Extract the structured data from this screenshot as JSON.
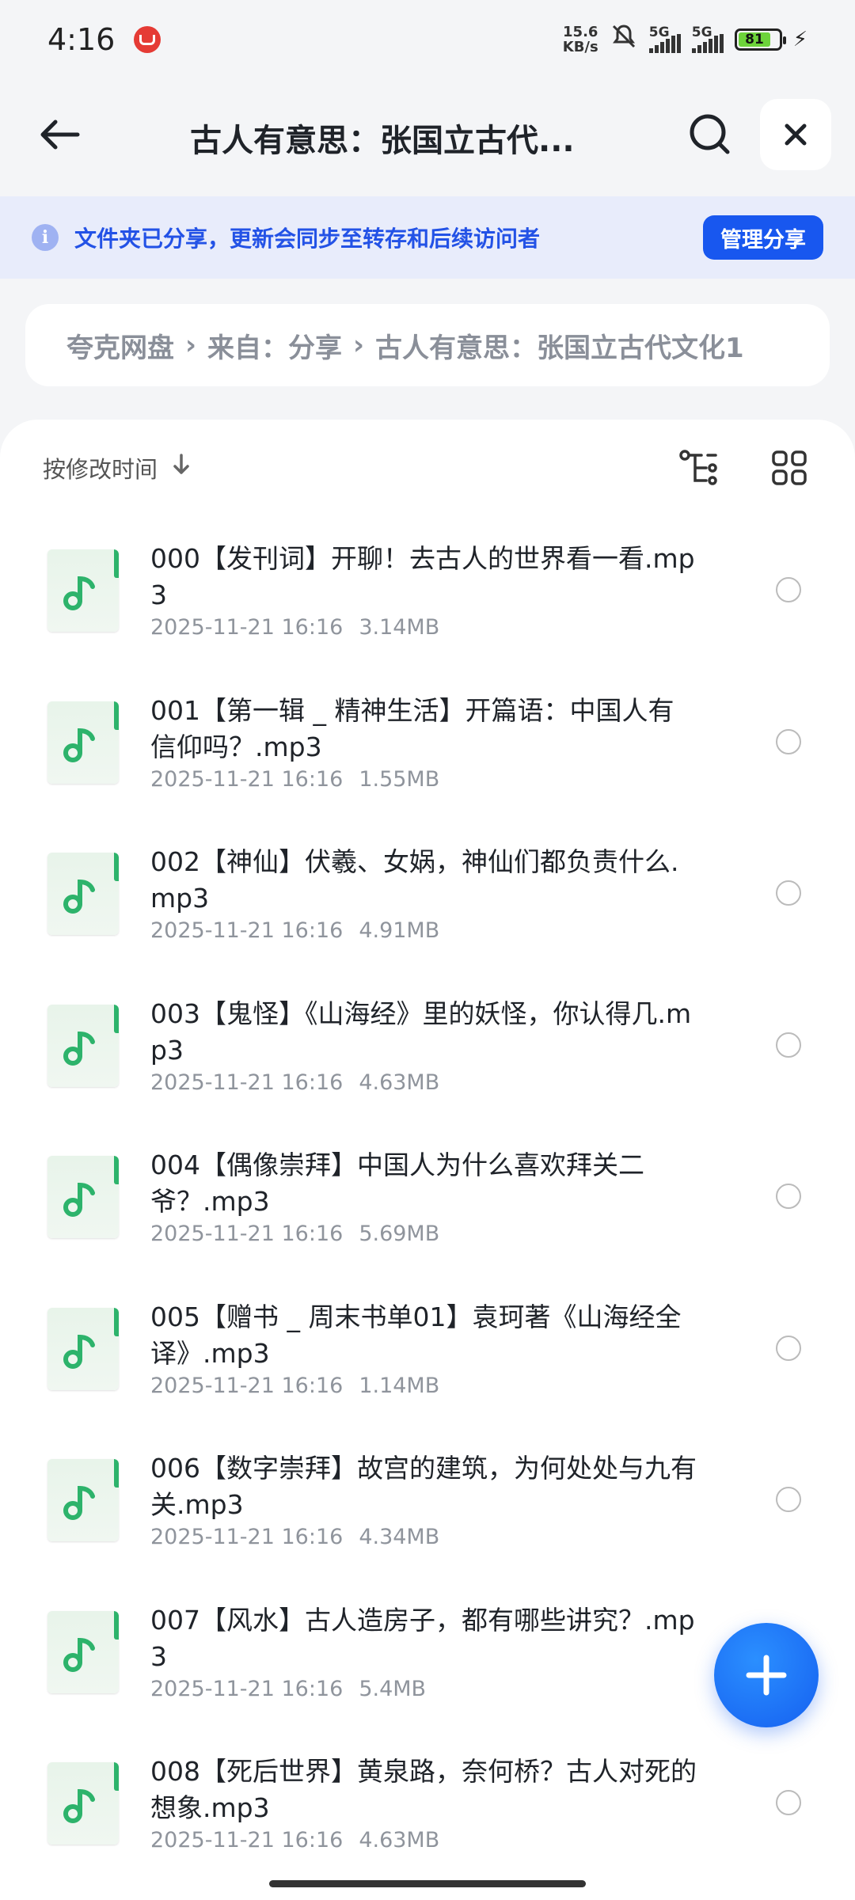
{
  "status_bar": {
    "time": "4:16",
    "speed_value": "15.6",
    "speed_unit": "KB/s",
    "sim1": "5G",
    "sim2": "5G",
    "battery": "81"
  },
  "header": {
    "title": "古人有意思：张国立古代..."
  },
  "banner": {
    "text": "文件夹已分享，更新会同步至转存和后续访问者",
    "manage_label": "管理分享"
  },
  "breadcrumb": {
    "items": [
      "夸克网盘",
      "来自：分享",
      "古人有意思：张国立古代文化1"
    ]
  },
  "toolbar": {
    "sort_label": "按修改时间"
  },
  "files": [
    {
      "name": "000【发刊词】开聊！去古人的世界看一看.mp3",
      "date": "2025-11-21 16:16",
      "size": "3.14MB"
    },
    {
      "name": "001【第一辑 _ 精神生活】开篇语：中国人有信仰吗？.mp3",
      "date": "2025-11-21 16:16",
      "size": "1.55MB"
    },
    {
      "name": "002【神仙】伏羲、女娲，神仙们都负责什么.mp3",
      "date": "2025-11-21 16:16",
      "size": "4.91MB"
    },
    {
      "name": "003【鬼怪】《山海经》里的妖怪，你认得几.mp3",
      "date": "2025-11-21 16:16",
      "size": "4.63MB"
    },
    {
      "name": "004【偶像崇拜】中国人为什么喜欢拜关二爷？.mp3",
      "date": "2025-11-21 16:16",
      "size": "5.69MB"
    },
    {
      "name": "005【赠书 _ 周末书单01】袁珂著《山海经全译》.mp3",
      "date": "2025-11-21 16:16",
      "size": "1.14MB"
    },
    {
      "name": "006【数字崇拜】故宫的建筑，为何处处与九有关.mp3",
      "date": "2025-11-21 16:16",
      "size": "4.34MB"
    },
    {
      "name": "007【风水】古人造房子，都有哪些讲究？.mp3",
      "date": "2025-11-21 16:16",
      "size": "5.4MB"
    },
    {
      "name": "008【死后世界】黄泉路，奈何桥？古人对死的想象.mp3",
      "date": "2025-11-21 16:16",
      "size": "4.63MB"
    }
  ],
  "colors": {
    "accent": "#1857ef",
    "banner_bg": "#e8ecfb",
    "file_icon_green": "#2db36b"
  }
}
